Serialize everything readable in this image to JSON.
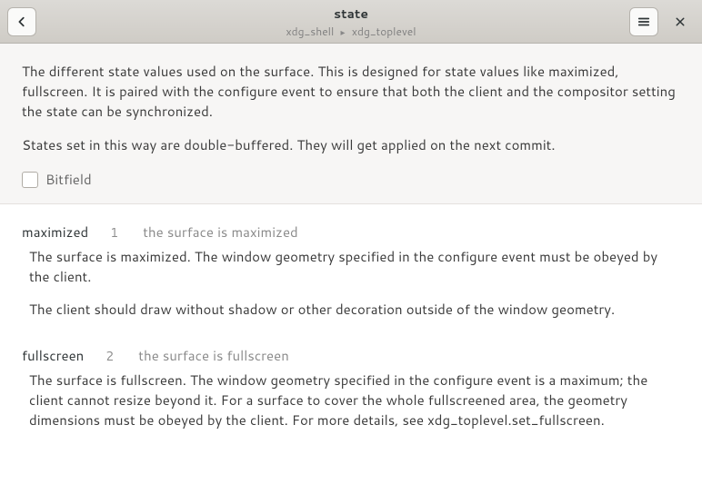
{
  "header": {
    "title": "state",
    "breadcrumb_parent": "xdg_shell",
    "breadcrumb_child": "xdg_toplevel"
  },
  "description": {
    "para1": "The different state values used on the surface. This is designed for state values like maximized, fullscreen. It is paired with the configure event to ensure that both the client and the compositor setting the state can be synchronized.",
    "para2": "States set in this way are double-buffered. They will get applied on the next commit."
  },
  "bitfield": {
    "label": "Bitfield",
    "checked": false
  },
  "entries": [
    {
      "name": "maximized",
      "value": "1",
      "summary": "the surface is maximized",
      "body_p1": "The surface is maximized. The window geometry specified in the configure   event must be obeyed by the client.",
      "body_p2": "The client should draw without shadow or other   decoration outside of the window geometry."
    },
    {
      "name": "fullscreen",
      "value": "2",
      "summary": "the surface is fullscreen",
      "body_p1": "The surface is fullscreen. The window geometry specified in the   configure event is a maximum; the client cannot resize beyond it. For   a surface to cover the whole fullscreened area, the geometry   dimensions must be obeyed by the client. For more details, see   xdg_toplevel.set_fullscreen.",
      "body_p2": ""
    }
  ]
}
